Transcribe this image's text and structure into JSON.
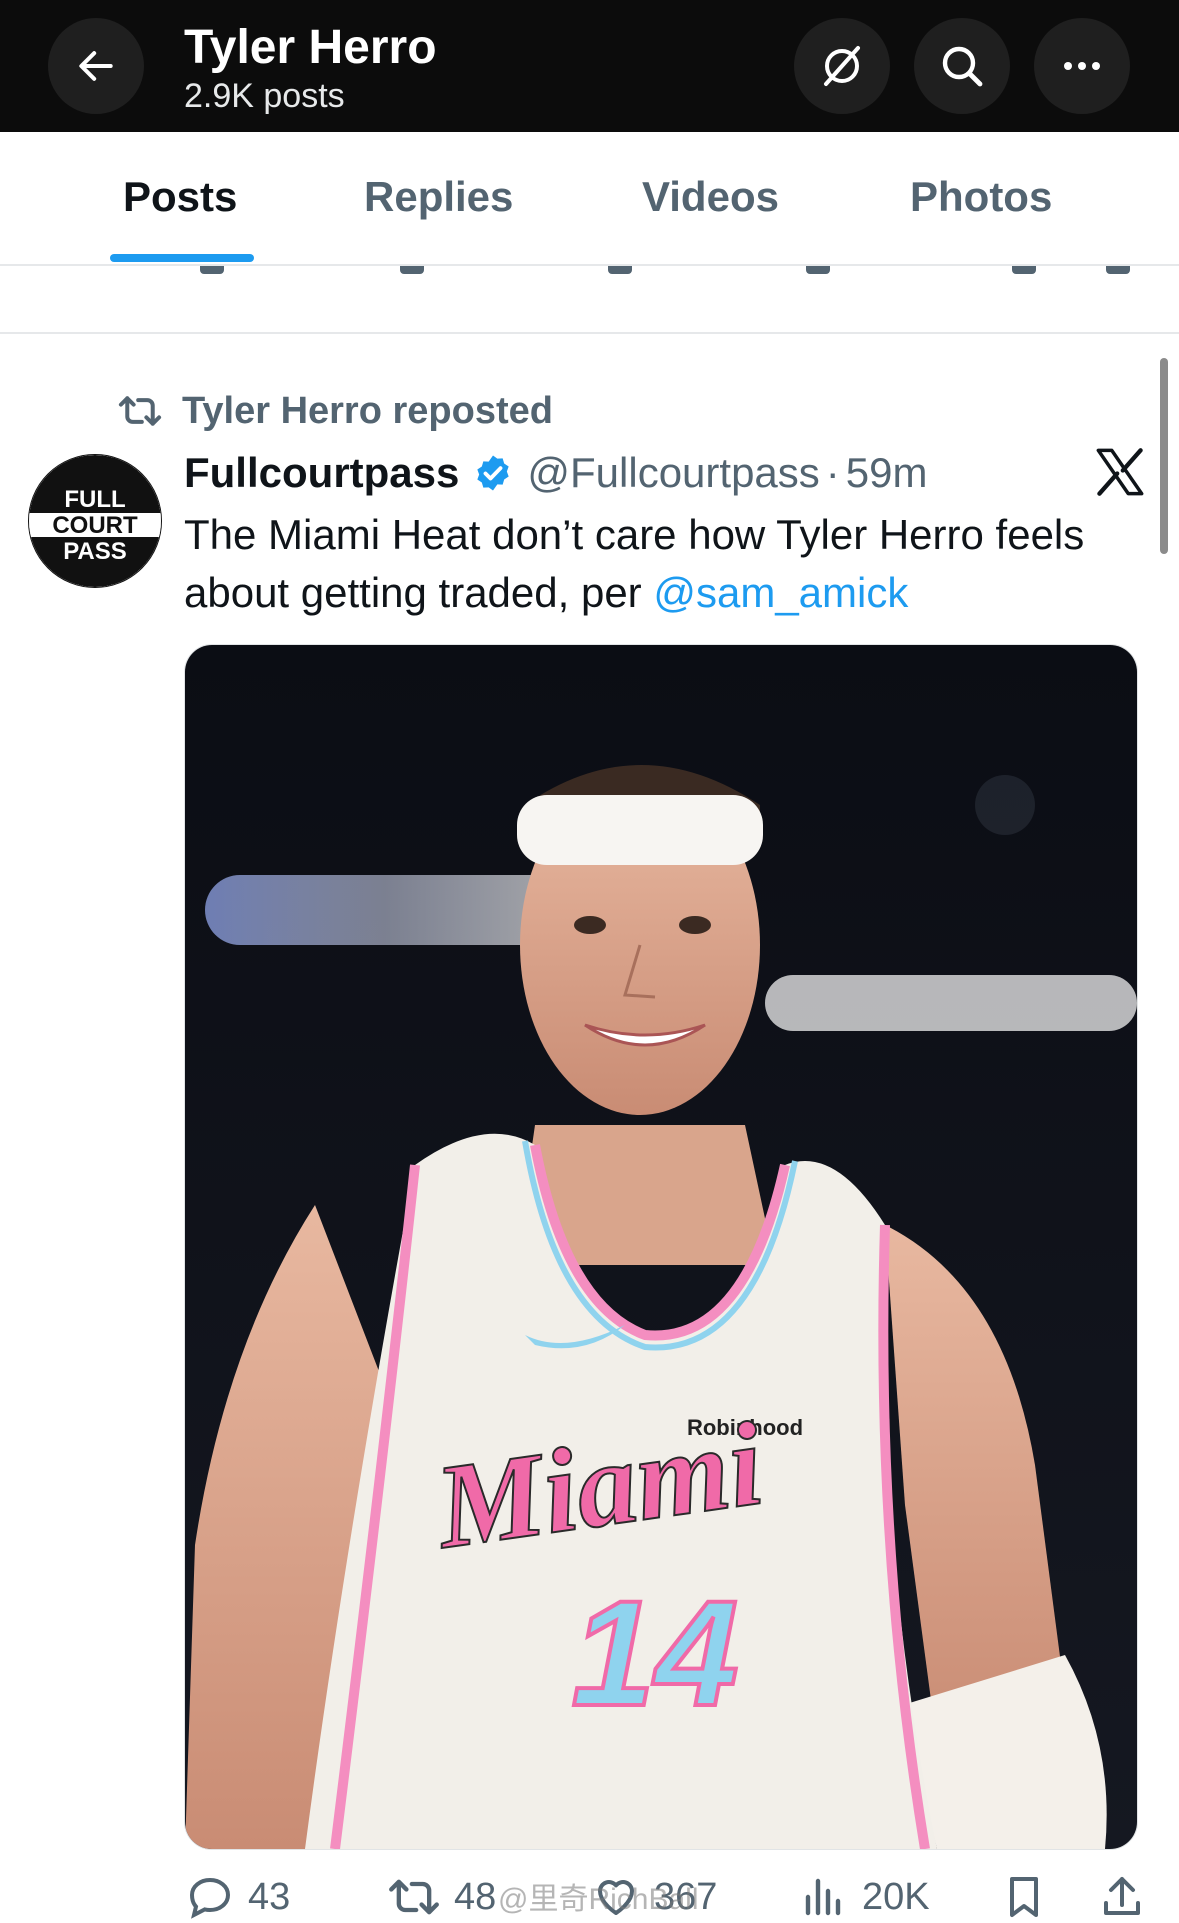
{
  "header": {
    "title": "Tyler Herro",
    "subtitle": "2.9K posts"
  },
  "tabs": [
    {
      "label": "Posts",
      "active": true
    },
    {
      "label": "Replies",
      "active": false
    },
    {
      "label": "Videos",
      "active": false
    },
    {
      "label": "Photos",
      "active": false
    }
  ],
  "post": {
    "repost_label": "Tyler Herro reposted",
    "author_name": "Fullcourtpass",
    "handle": "@Fullcourtpass",
    "separator": "·",
    "time": "59m",
    "text": "The Miami Heat don’t care how Tyler Herro feels about getting traded, per ",
    "mention": "@sam_amick",
    "avatar_text": [
      "FULL",
      "COURT",
      "PASS"
    ],
    "image_text": {
      "sponsor": "Robinhood",
      "jersey_script": "Miami",
      "jersey_number": "14"
    },
    "actions": {
      "replies": "43",
      "reposts": "48",
      "likes": "367",
      "views": "20K"
    }
  },
  "watermark": "@里奇RichBall",
  "colors": {
    "header_bg": "#0c0c0c",
    "accent": "#1d9bf0",
    "muted": "#536471",
    "text": "#0f1419"
  },
  "icons": {
    "header": [
      "back-arrow-icon",
      "grok-icon",
      "search-icon",
      "more-icon"
    ],
    "actions": [
      "reply-icon",
      "repost-icon",
      "like-icon",
      "views-icon",
      "bookmark-icon",
      "share-icon"
    ]
  }
}
